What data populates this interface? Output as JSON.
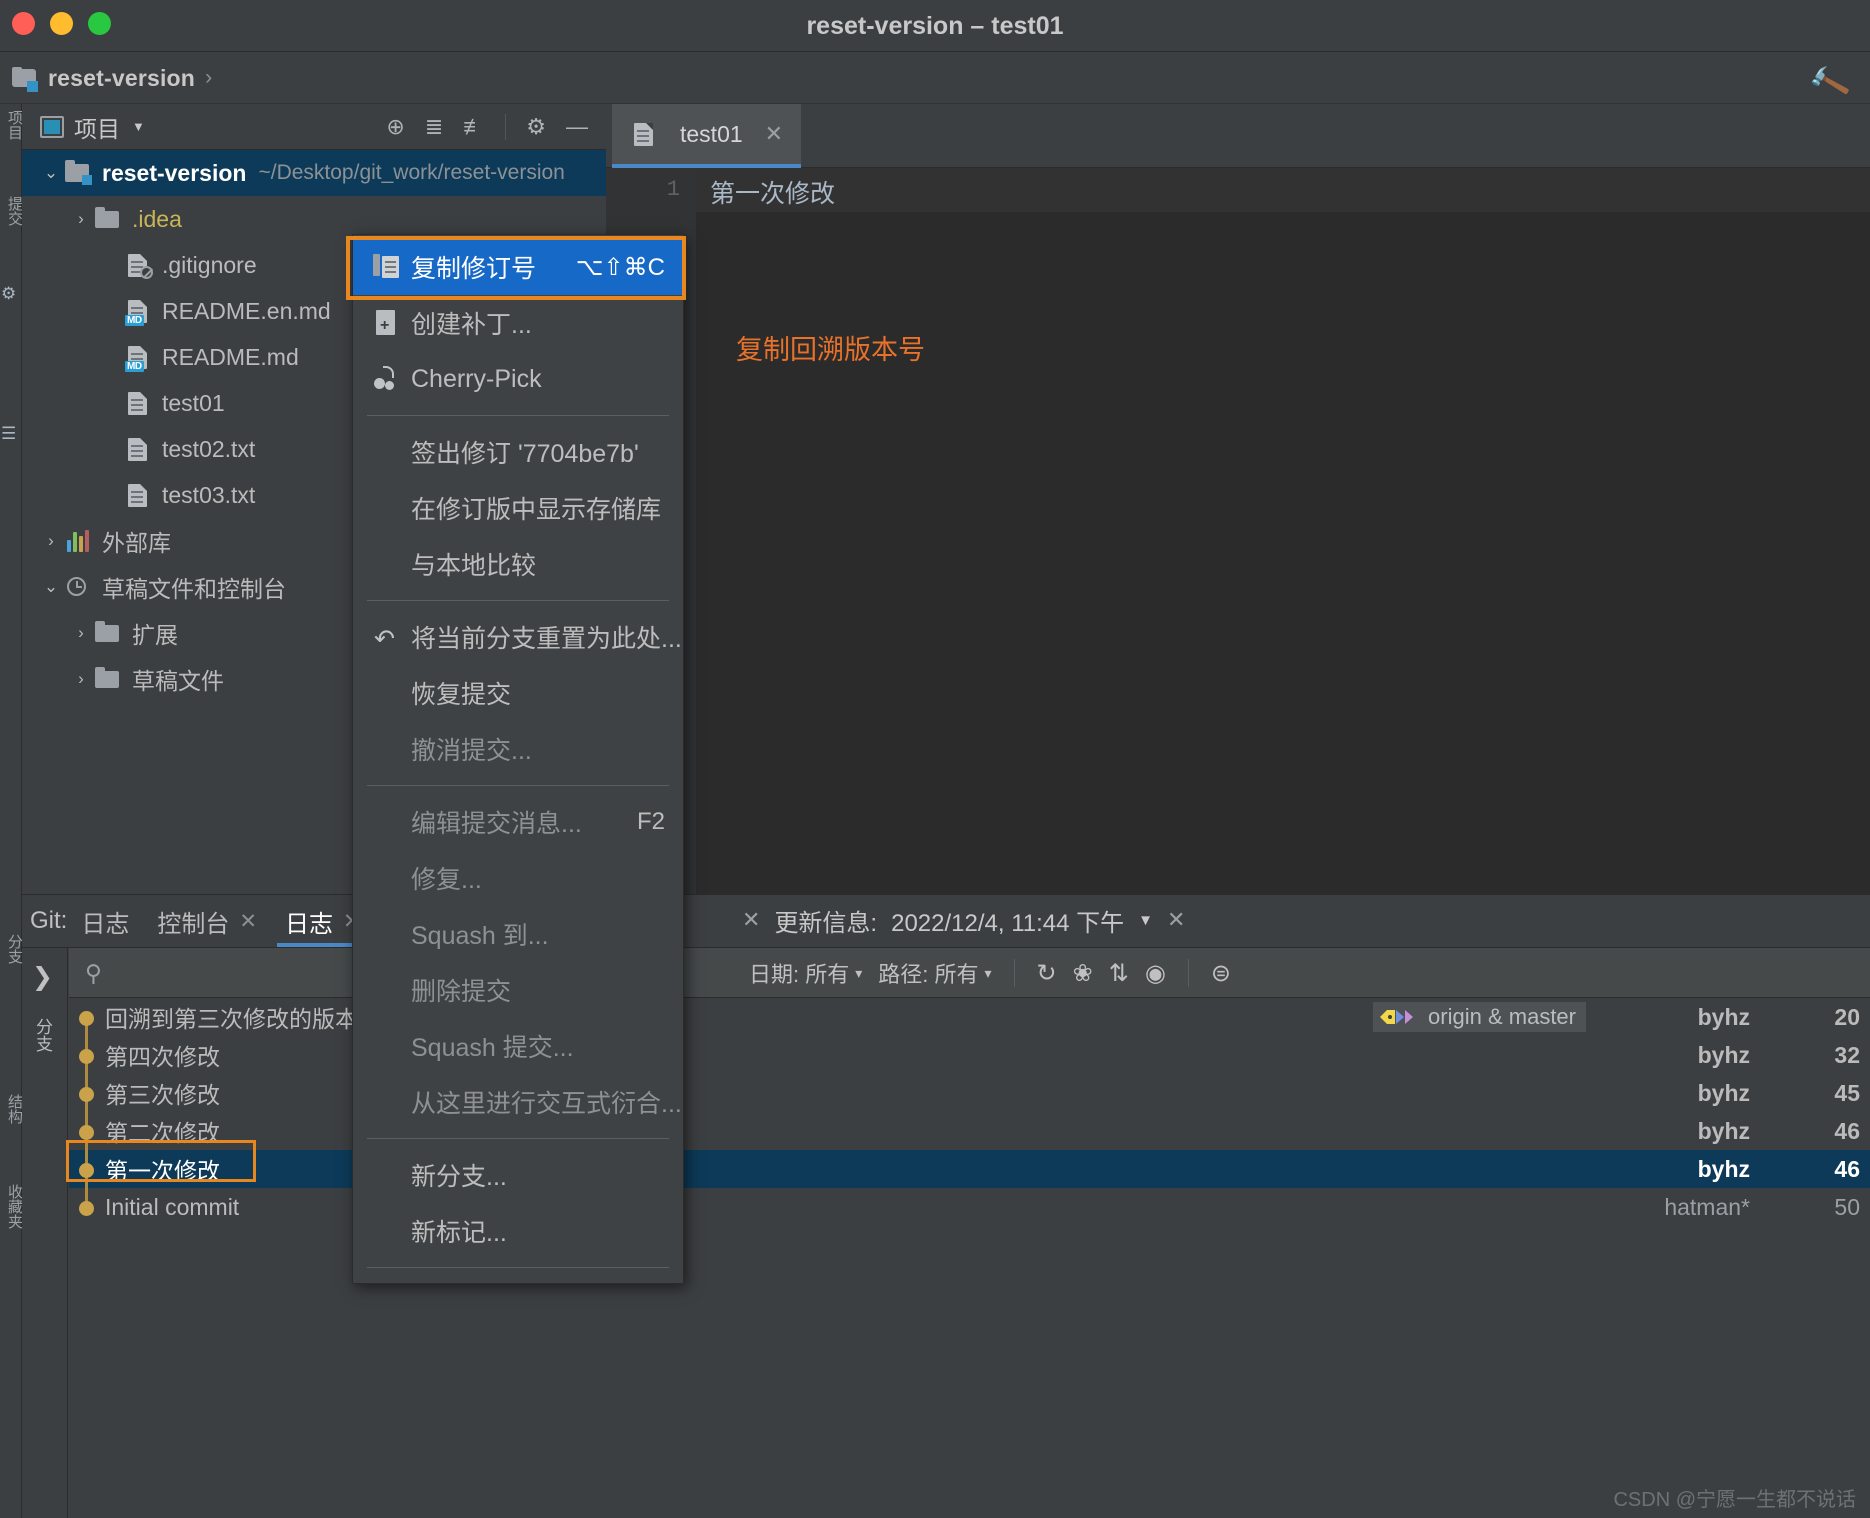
{
  "window": {
    "title": "reset-version – test01"
  },
  "breadcrumb": {
    "project": "reset-version",
    "separator": "›",
    "folder_icon": "project-folder-icon",
    "hammer_icon": "build-hammer-icon"
  },
  "rail": {
    "items": [
      {
        "label": "项目",
        "name": "rail-project"
      },
      {
        "label": "提交",
        "name": "rail-commit"
      },
      {
        "label": "分支",
        "name": "rail-branch"
      },
      {
        "label": "结构",
        "name": "rail-structure"
      },
      {
        "label": "收藏夹",
        "name": "rail-bookmarks"
      }
    ]
  },
  "project_panel": {
    "title": "项目",
    "caret": "▼",
    "tools": [
      {
        "name": "locate-icon",
        "glyph": "⊕"
      },
      {
        "name": "expand-all-icon",
        "glyph": "⧉"
      },
      {
        "name": "collapse-all-icon",
        "glyph": "⧉"
      },
      {
        "name": "settings-gear-icon",
        "glyph": "⚙"
      },
      {
        "name": "hide-icon",
        "glyph": "—"
      }
    ],
    "tree": [
      {
        "name": "reset-version",
        "path": "~/Desktop/git_work/reset-version",
        "icon": "module",
        "arrow": "⌄",
        "selected": true,
        "indent": 0
      },
      {
        "name": ".idea",
        "path": "",
        "icon": "folder",
        "arrow": "›",
        "selected": false,
        "indent": 1,
        "color": "yellow"
      },
      {
        "name": ".gitignore",
        "path": "",
        "icon": "file-ignored",
        "arrow": "",
        "selected": false,
        "indent": 2
      },
      {
        "name": "README.en.md",
        "path": "",
        "icon": "file-md",
        "arrow": "",
        "selected": false,
        "indent": 2
      },
      {
        "name": "README.md",
        "path": "",
        "icon": "file-md",
        "arrow": "",
        "selected": false,
        "indent": 2
      },
      {
        "name": "test01",
        "path": "",
        "icon": "file",
        "arrow": "",
        "selected": false,
        "indent": 2
      },
      {
        "name": "test02.txt",
        "path": "",
        "icon": "file",
        "arrow": "",
        "selected": false,
        "indent": 2
      },
      {
        "name": "test03.txt",
        "path": "",
        "icon": "file",
        "arrow": "",
        "selected": false,
        "indent": 2
      },
      {
        "name": "外部库",
        "path": "",
        "icon": "lib",
        "arrow": "›",
        "selected": false,
        "indent": 0
      },
      {
        "name": "草稿文件和控制台",
        "path": "",
        "icon": "scratch",
        "arrow": "⌄",
        "selected": false,
        "indent": 0
      },
      {
        "name": "扩展",
        "path": "",
        "icon": "folder",
        "arrow": "›",
        "selected": false,
        "indent": 1
      },
      {
        "name": "草稿文件",
        "path": "",
        "icon": "folder",
        "arrow": "›",
        "selected": false,
        "indent": 1
      }
    ]
  },
  "editor": {
    "tab": {
      "label": "test01",
      "close": "✕",
      "icon": "file-icon"
    },
    "line_number": "1",
    "line_text": "第一次修改",
    "annotation": "复制回溯版本号"
  },
  "context_menu": {
    "items": [
      {
        "label": "复制修订号",
        "shortcut": "⌥⇧⌘C",
        "icon": "copy-revision-icon",
        "selected": true,
        "disabled": false
      },
      {
        "label": "创建补丁...",
        "shortcut": "",
        "icon": "create-patch-icon",
        "selected": false,
        "disabled": false
      },
      {
        "label": "Cherry-Pick",
        "shortcut": "",
        "icon": "cherry-pick-icon",
        "selected": false,
        "disabled": false
      },
      {
        "separator": true
      },
      {
        "label": "签出修订 '7704be7b'",
        "shortcut": "",
        "icon": "",
        "selected": false,
        "disabled": false
      },
      {
        "label": "在修订版中显示存储库",
        "shortcut": "",
        "icon": "",
        "selected": false,
        "disabled": false
      },
      {
        "label": "与本地比较",
        "shortcut": "",
        "icon": "",
        "selected": false,
        "disabled": false
      },
      {
        "separator": true
      },
      {
        "label": "将当前分支重置为此处...",
        "shortcut": "",
        "icon": "reset-branch-icon",
        "selected": false,
        "disabled": false
      },
      {
        "label": "恢复提交",
        "shortcut": "",
        "icon": "",
        "selected": false,
        "disabled": false
      },
      {
        "label": "撤消提交...",
        "shortcut": "",
        "icon": "",
        "selected": false,
        "disabled": true
      },
      {
        "separator": true
      },
      {
        "label": "编辑提交消息...",
        "shortcut": "F2",
        "icon": "",
        "selected": false,
        "disabled": true
      },
      {
        "label": "修复...",
        "shortcut": "",
        "icon": "",
        "selected": false,
        "disabled": true
      },
      {
        "label": "Squash 到...",
        "shortcut": "",
        "icon": "",
        "selected": false,
        "disabled": true
      },
      {
        "label": "删除提交",
        "shortcut": "",
        "icon": "",
        "selected": false,
        "disabled": true
      },
      {
        "label": "Squash 提交...",
        "shortcut": "",
        "icon": "",
        "selected": false,
        "disabled": true
      },
      {
        "label": "从这里进行交互式衍合...",
        "shortcut": "",
        "icon": "",
        "selected": false,
        "disabled": true
      },
      {
        "separator": true
      },
      {
        "label": "新分支...",
        "shortcut": "",
        "icon": "",
        "selected": false,
        "disabled": false
      },
      {
        "label": "新标记...",
        "shortcut": "",
        "icon": "",
        "selected": false,
        "disabled": false
      },
      {
        "separator": true
      }
    ]
  },
  "git_panel": {
    "label": "Git:",
    "tabs": [
      {
        "label": "日志",
        "closable": false,
        "active": false
      },
      {
        "label": "控制台",
        "closable": true,
        "active": false
      },
      {
        "label": "日志",
        "closable": true,
        "active": true
      }
    ],
    "expand_icon": "❯",
    "side_label": "分支",
    "search_placeholder": "",
    "filters": [
      {
        "label": "日期: 所有"
      },
      {
        "label": "路径: 所有"
      }
    ],
    "filter_icons": [
      {
        "name": "refresh-icon",
        "glyph": "↻"
      },
      {
        "name": "cherry-pick-icon",
        "glyph": "❀"
      },
      {
        "name": "sort-icon",
        "glyph": "⇅"
      },
      {
        "name": "show-details-icon",
        "glyph": "◉"
      },
      {
        "name": "expand-panel-icon",
        "glyph": "⧉"
      }
    ],
    "update_info": {
      "prefix": "更新信息:",
      "timestamp": "2022/12/4, 11:44 下午",
      "caret": "▼",
      "close": "✕"
    },
    "commits": [
      {
        "subject": "回溯到第三次修改的版本",
        "ref": "origin & master",
        "author": "byhz",
        "date": "20",
        "selected": false
      },
      {
        "subject": "第四次修改",
        "ref": "",
        "author": "byhz",
        "date": "32",
        "selected": false
      },
      {
        "subject": "第三次修改",
        "ref": "",
        "author": "byhz",
        "date": "45",
        "selected": false
      },
      {
        "subject": "第二次修改",
        "ref": "",
        "author": "byhz",
        "date": "46",
        "selected": false
      },
      {
        "subject": "第一次修改",
        "ref": "",
        "author": "byhz",
        "date": "46",
        "selected": true
      },
      {
        "subject": "Initial commit",
        "ref": "",
        "author": "hatman*",
        "date": "50",
        "selected": false,
        "faint": true
      }
    ]
  },
  "watermark": {
    "text": "CSDN @宁愿一生都不说话"
  },
  "colors": {
    "accent_blue": "#1769c8",
    "highlight_orange": "#e8861f",
    "selection_navy": "#0d3a58",
    "graph_gold": "#c9a24a",
    "tab_underline": "#4a88c7"
  }
}
